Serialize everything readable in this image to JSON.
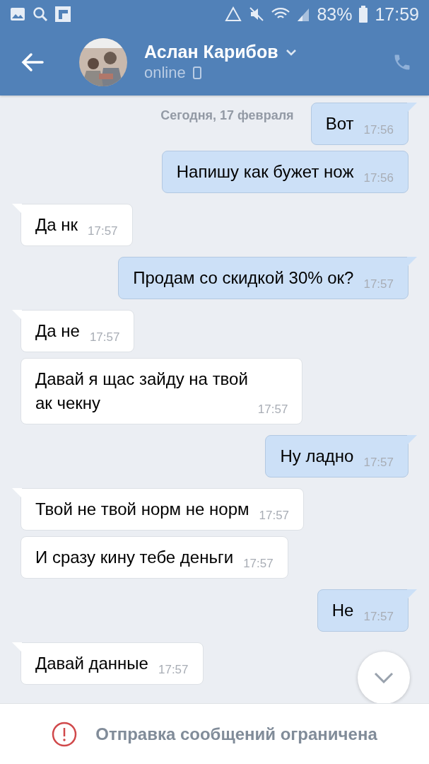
{
  "status_bar": {
    "battery": "83%",
    "time": "17:59"
  },
  "header": {
    "name": "Аслан Карибов",
    "status": "online"
  },
  "date_label": "Сегодня, 17 февраля",
  "messages": [
    {
      "outgoing": true,
      "tail": true,
      "text": "Вот",
      "time": "17:56"
    },
    {
      "outgoing": true,
      "tail": false,
      "text": "Напишу как бужет нож",
      "time": "17:56"
    },
    {
      "outgoing": false,
      "tail": true,
      "text": "Да нк",
      "time": "17:57"
    },
    {
      "outgoing": true,
      "tail": true,
      "text": "Продам со скидкой 30% ок?",
      "time": "17:57"
    },
    {
      "outgoing": false,
      "tail": true,
      "text": "Да не",
      "time": "17:57"
    },
    {
      "outgoing": false,
      "tail": false,
      "text": "Давай я щас зайду на твой\nак чекну",
      "time": "17:57"
    },
    {
      "outgoing": true,
      "tail": true,
      "text": "Ну ладно",
      "time": "17:57"
    },
    {
      "outgoing": false,
      "tail": true,
      "text": "Твой не твой норм не норм",
      "time": "17:57"
    },
    {
      "outgoing": false,
      "tail": false,
      "text": "И сразу кину тебе деньги",
      "time": "17:57"
    },
    {
      "outgoing": true,
      "tail": true,
      "text": "Не",
      "time": "17:57"
    },
    {
      "outgoing": false,
      "tail": true,
      "text": "Давай данные",
      "time": "17:57"
    }
  ],
  "notice": "Отправка сообщений ограничена"
}
